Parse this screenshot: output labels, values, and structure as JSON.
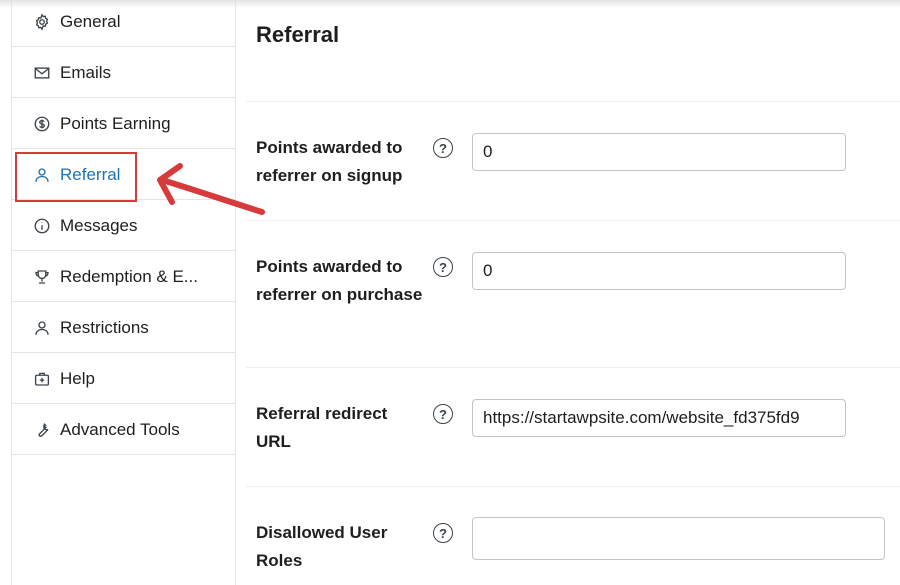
{
  "sidebar": {
    "items": [
      {
        "label": "General",
        "icon": "gear-icon"
      },
      {
        "label": "Emails",
        "icon": "envelope-icon"
      },
      {
        "label": "Points Earning",
        "icon": "dollar-circle-icon"
      },
      {
        "label": "Referral",
        "icon": "user-icon",
        "active": true
      },
      {
        "label": "Messages",
        "icon": "info-circle-icon"
      },
      {
        "label": "Redemption & E...",
        "icon": "trophy-icon"
      },
      {
        "label": "Restrictions",
        "icon": "user-icon"
      },
      {
        "label": "Help",
        "icon": "first-aid-kit-icon"
      },
      {
        "label": "Advanced Tools",
        "icon": "wrench-icon"
      }
    ]
  },
  "main": {
    "title": "Referral",
    "fields": [
      {
        "label": "Points awarded to referrer on signup",
        "value": "0"
      },
      {
        "label": "Points awarded to referrer on purchase",
        "value": "0"
      },
      {
        "label": "Referral redirect URL",
        "value": "https://startawpsite.com/website_fd375fd9"
      },
      {
        "label": "Disallowed User Roles",
        "value": ""
      }
    ],
    "help_glyph": "?"
  },
  "colors": {
    "accent": "#2271b1",
    "highlight": "#d63a3a",
    "border": "#c3c4c7"
  }
}
